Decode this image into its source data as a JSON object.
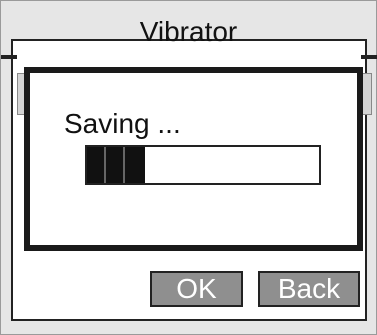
{
  "screen": {
    "title": "Vibrator"
  },
  "buttons": {
    "ok_label": "OK",
    "back_label": "Back"
  },
  "dialog": {
    "message": "Saving ...",
    "progress": 0.25
  },
  "colors": {
    "bar": "#111111",
    "button": "#8f8f8f",
    "border": "#222222"
  }
}
